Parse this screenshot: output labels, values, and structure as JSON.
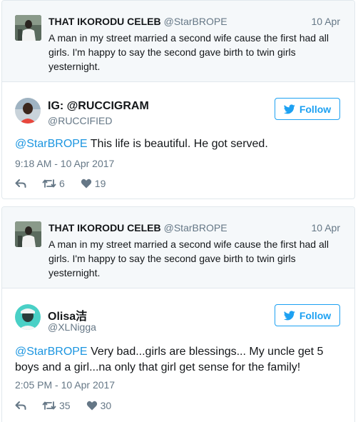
{
  "colors": {
    "accent": "#1da1f2",
    "mention": "#1b95e0",
    "muted": "#657786",
    "border": "#e1e8ed",
    "quoted_bg": "#f5f8fa"
  },
  "tweets": [
    {
      "quoted": {
        "name": "THAT IKORODU CELEB",
        "handle": "@StarBROPE",
        "date": "10 Apr",
        "text": "A man in my street married a second wife cause the first had all girls. I'm happy to say the second gave birth to twin girls yesternight."
      },
      "author": {
        "name": "IG: @RUCCIGRAM",
        "handle": "@RUCCIFIED"
      },
      "follow_label": "Follow",
      "mention": "@StarBROPE",
      "body": "This life is beautiful. He got served.",
      "timestamp": "9:18 AM - 10 Apr 2017",
      "retweets": "6",
      "likes": "19",
      "icons": {
        "reply": "reply-icon",
        "retweet": "retweet-icon",
        "like": "heart-icon",
        "follow": "twitter-bird-icon"
      }
    },
    {
      "quoted": {
        "name": "THAT IKORODU CELEB",
        "handle": "@StarBROPE",
        "date": "10 Apr",
        "text": "A man in my street married a second wife cause the first had all girls. I'm happy to say the second gave birth to twin girls yesternight."
      },
      "author": {
        "name": "Olisa洁",
        "handle": "@XLNigga"
      },
      "follow_label": "Follow",
      "mention": "@StarBROPE",
      "body": "Very bad...girls are blessings... My uncle get 5 boys and a girl...na only that girl get sense for the family!",
      "timestamp": "2:05 PM - 10 Apr 2017",
      "retweets": "35",
      "likes": "30",
      "icons": {
        "reply": "reply-icon",
        "retweet": "retweet-icon",
        "like": "heart-icon",
        "follow": "twitter-bird-icon"
      }
    }
  ]
}
